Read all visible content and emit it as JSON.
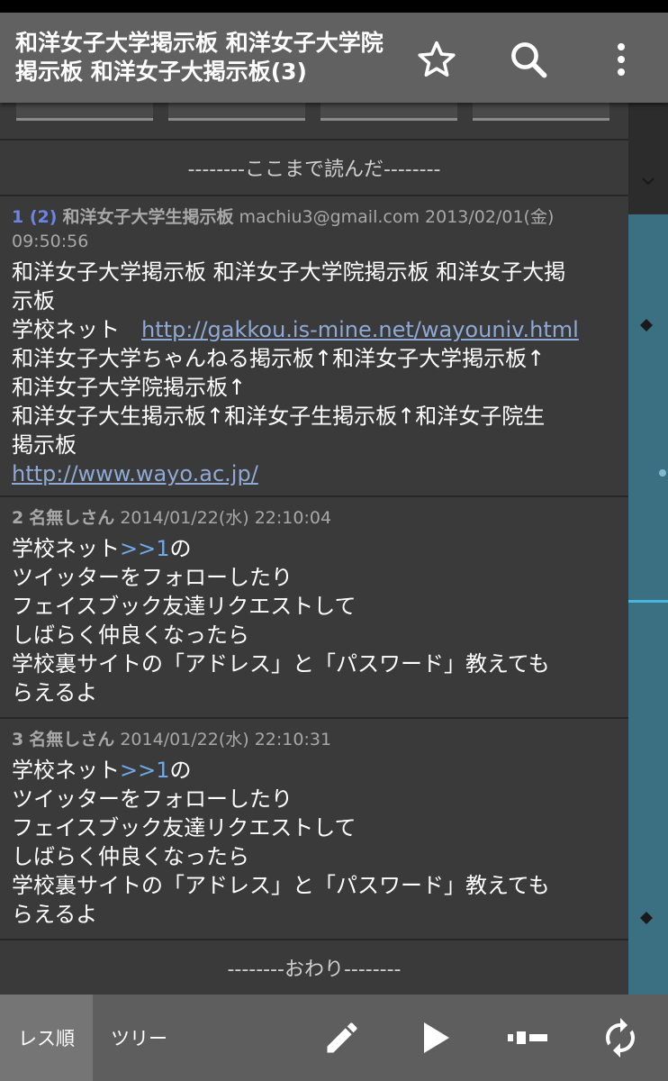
{
  "appbar": {
    "title": "和洋女子大学掲示板 和洋女子大学院掲示板 和洋女子大掲示板(3)",
    "actions": {
      "favorite_icon": "star-outline-icon",
      "search_icon": "search-icon",
      "menu_icon": "more-vert-icon"
    }
  },
  "marker": {
    "read_until": "--------ここまで読んだ--------",
    "end": "--------おわり--------"
  },
  "posts": [
    {
      "number": "1 (2)",
      "name": "和洋女子大学生掲示板",
      "mail": "machiu3@gmail.com",
      "date": "2013/02/01(金)",
      "time": "09:50:56",
      "body": {
        "l1": "和洋女子大学掲示板 和洋女子大学院掲示板 和洋女子大掲",
        "l2": "示板",
        "l3_prefix": "学校ネット　",
        "l3_link": "http://gakkou.is-mine.net/wayouniv.html",
        "l4": "和洋女子大学ちゃんねる掲示板↑和洋女子大学掲示板↑",
        "l5": "和洋女子大学院掲示板↑",
        "l6": "和洋女子大生掲示板↑和洋女子生掲示板↑和洋女子院生",
        "l7": "掲示板",
        "l8_link": "http://www.wayo.ac.jp/"
      }
    },
    {
      "number": "2",
      "name": "名無しさん",
      "date": "2014/01/22(水) 22:10:04",
      "body": {
        "l1_prefix": "学校ネット",
        "l1_anchor": ">>1",
        "l1_suffix": "の",
        "l2": "ツイッターをフォローしたり",
        "l3": "フェイスブック友達リクエストして",
        "l4": "しばらく仲良くなったら",
        "l5": "学校裏サイトの「アドレス」と「パスワード」教えても",
        "l6": "らえるよ"
      }
    },
    {
      "number": "3",
      "name": "名無しさん",
      "date": "2014/01/22(水) 22:10:31",
      "body": {
        "l1_prefix": "学校ネット",
        "l1_anchor": ">>1",
        "l1_suffix": "の",
        "l2": "ツイッターをフォローしたり",
        "l3": "フェイスブック友達リクエストして",
        "l4": "しばらく仲良くなったら",
        "l5": "学校裏サイトの「アドレス」と「パスワード」教えても",
        "l6": "らえるよ"
      }
    }
  ],
  "bottombar": {
    "tabs": [
      {
        "label": "レス順",
        "active": true
      },
      {
        "label": "ツリー",
        "active": false
      }
    ],
    "icons": [
      "pencil-icon",
      "play-icon",
      "seekbar-icon",
      "refresh-icon"
    ]
  },
  "colors": {
    "appbar": "#616161",
    "background": "#3a3a3a",
    "post_number": "#6b85e6",
    "link": "#8fa9d6",
    "anchor": "#70a8e8",
    "scroll_track": "#3a7082",
    "scroll_current": "#49b6e0"
  }
}
